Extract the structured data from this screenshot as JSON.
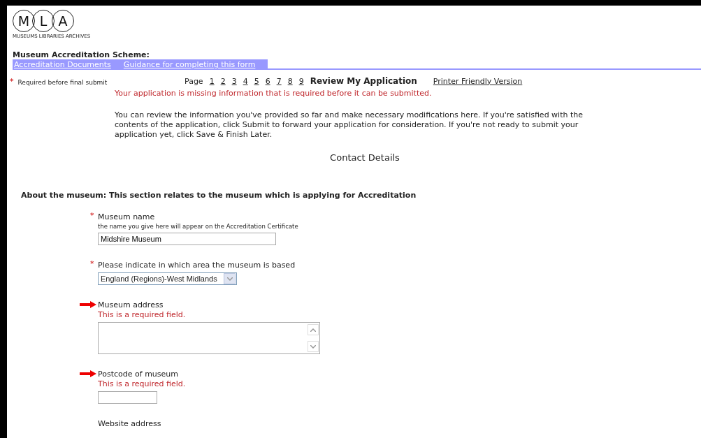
{
  "logo": {
    "letters": [
      "M",
      "L",
      "A"
    ],
    "tagline": "MUSEUMS LIBRARIES ARCHIVES"
  },
  "scheme_title": "Museum Accreditation Scheme:",
  "nav_links": [
    "Accreditation Documents",
    "Guidance for completing this form"
  ],
  "required_note": {
    "mark": "*",
    "text": "Required before final submit"
  },
  "pager": {
    "label": "Page",
    "pages": [
      {
        "label": "1",
        "selected": false
      },
      {
        "label": "2",
        "selected": false
      },
      {
        "label": "3",
        "selected": false
      },
      {
        "label": "4",
        "selected": false
      },
      {
        "label": "5",
        "selected": false
      },
      {
        "label": "6",
        "selected": false
      },
      {
        "label": "7",
        "selected": false
      },
      {
        "label": "8",
        "selected": false
      },
      {
        "label": "9",
        "selected": false
      },
      {
        "label": "Review My Application",
        "selected": true
      }
    ],
    "printer_link": "Printer Friendly Version"
  },
  "error_message": "Your application is missing information that is required before it can be submitted.",
  "intro": "You can review the information you've provided so far and make necessary modifications here. If you're satisfied with the contents of the application, click Submit to forward your application for consideration. If you're not ready to submit your application yet, click Save & Finish Later.",
  "section_heading": "Contact Details",
  "subsection": "About the museum: This section relates to the museum which is applying for Accreditation",
  "fields": [
    {
      "kind": "text",
      "required": true,
      "missing": false,
      "label": "Museum name",
      "hint": "the name you give here will appear on the Accreditation Certificate",
      "value": "Midshire Museum"
    },
    {
      "kind": "select",
      "required": true,
      "missing": false,
      "label": "Please indicate in which area the museum is based",
      "value": "England (Regions)-West Midlands"
    },
    {
      "kind": "textarea",
      "required": false,
      "missing": true,
      "label": "Museum address",
      "error": "This is a required field."
    },
    {
      "kind": "short",
      "required": false,
      "missing": true,
      "label": "Postcode of museum",
      "error": "This is a required field."
    },
    {
      "kind": "label",
      "required": false,
      "missing": false,
      "label": "Website address"
    }
  ]
}
